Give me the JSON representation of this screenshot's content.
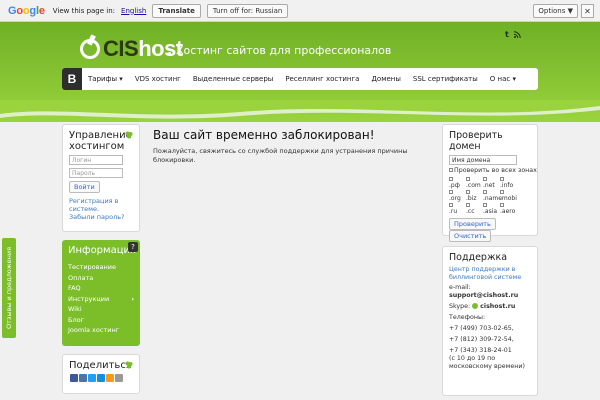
{
  "translate_bar": {
    "logo": "Google",
    "view_text": "View this page in:",
    "language": "English",
    "translate_button": "Translate",
    "turn_off_button": "Turn off for: Russian",
    "options_button": "Options ▼",
    "close_label": "✕"
  },
  "header": {
    "logo_prefix": "CIS",
    "logo_suffix": "host",
    "tagline": "Хостинг сайтов для профессионалов",
    "social": [
      "t",
      "rss"
    ]
  },
  "nav": {
    "home_label": "B",
    "items": [
      "Тарифы",
      "VDS хостинг",
      "Выделенные серверы",
      "Реселлинг хостинга",
      "Домены",
      "SSL сертификаты",
      "О нас"
    ]
  },
  "login": {
    "title": "Управление хостингом",
    "login_placeholder": "Логин",
    "password_placeholder": "Пароль",
    "submit_label": "Войти",
    "register_link": "Регистрация в системе.",
    "forgot_link": "Забыли пароль?"
  },
  "info": {
    "title": "Информация",
    "help_badge": "?",
    "items": [
      "Тестирование",
      "Оплата",
      "FAQ",
      "Инструкции",
      "Wiki",
      "Блог",
      "Joomla хостинг"
    ]
  },
  "share": {
    "title": "Поделиться"
  },
  "feedback": {
    "label": "Отзывы и предложения"
  },
  "main": {
    "title": "Ваш сайт временно заблокирован!",
    "message": "Пожалуйста, свяжитесь со службой поддержки для устранения причины блокировки."
  },
  "domain_check": {
    "title": "Проверить домен",
    "input_value": "Имя домена",
    "check_all_label": "Проверить во всех зонах",
    "zones": [
      ".рф",
      ".com",
      ".net",
      ".info",
      ".org",
      ".biz",
      ".name",
      ".mobi",
      ".ru",
      ".cc",
      ".asia",
      ".aero"
    ],
    "check_button": "Проверить",
    "clear_button": "Очистить"
  },
  "support": {
    "title": "Поддержка",
    "center_link": "Центр поддержки в биллинговой системе",
    "email_label": "e-mail:",
    "email": "support@cishost.ru",
    "skype_label": "Skype:",
    "skype": "cishost.ru",
    "phones_label": "Телефоны:",
    "phones": [
      "+7 (499) 703-02-65,",
      "+7 (812) 309-72-54,",
      "+7 (343) 318-24-01"
    ],
    "hours": "(с 10 до 19 по московскому времени)"
  },
  "colors": {
    "header_green": "#7cbd2a",
    "nav_dark": "#2e2e2e",
    "link_blue": "#3b7bbf"
  }
}
